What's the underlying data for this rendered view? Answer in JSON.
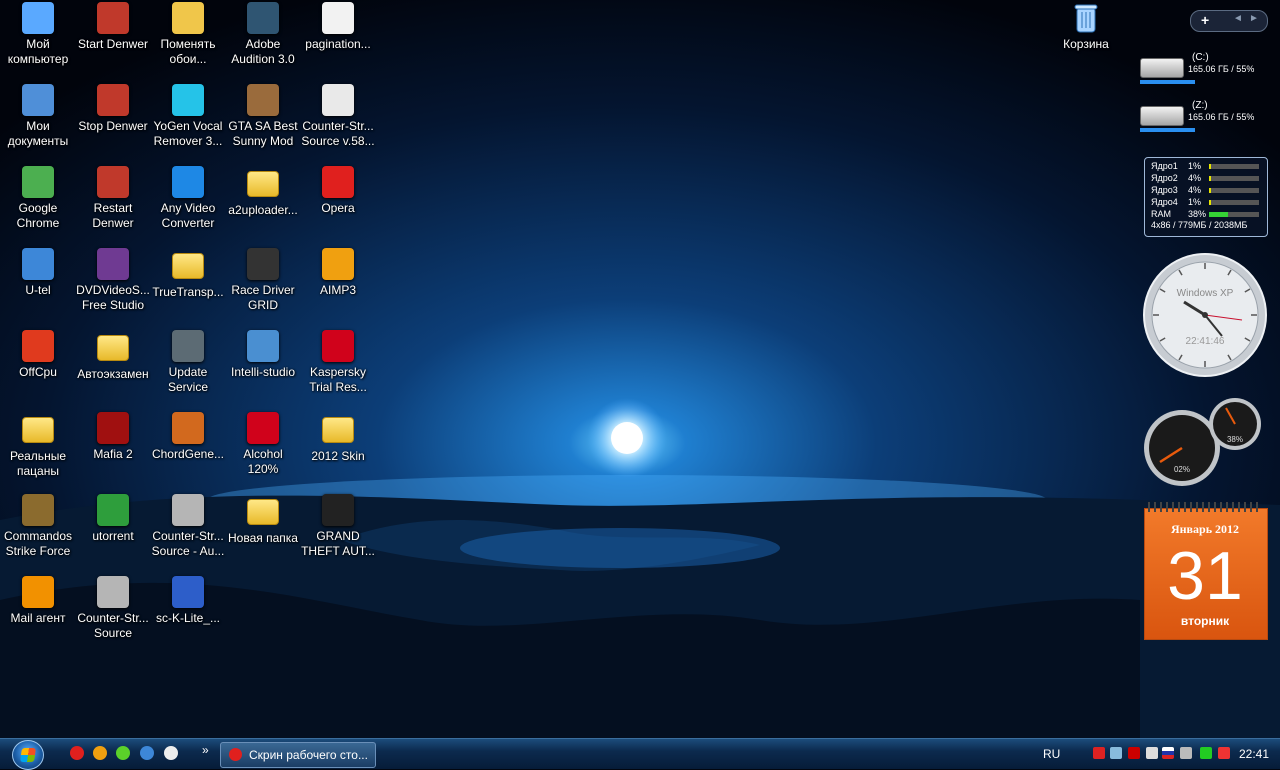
{
  "desktop_icons": [
    {
      "label": "Мой\nкомпьютер",
      "icon": "computer-icon"
    },
    {
      "label": "Start Denwer",
      "icon": "denwer-icon"
    },
    {
      "label": "Поменять\nобои...",
      "icon": "wallpaper-icon"
    },
    {
      "label": "Adobe\nAudition 3.0",
      "icon": "audition-icon"
    },
    {
      "label": "pagination...",
      "icon": "document-icon"
    },
    {
      "label": "Мои\nдокументы",
      "icon": "documents-icon"
    },
    {
      "label": "Stop Denwer",
      "icon": "denwer-icon"
    },
    {
      "label": "YoGen Vocal\nRemover 3...",
      "icon": "yogen-icon"
    },
    {
      "label": "GTA SA Best\nSunny Mod",
      "icon": "gta-icon"
    },
    {
      "label": "Counter-Str...\nSource v.58...",
      "icon": "window-icon"
    },
    {
      "label": "Google\nChrome",
      "icon": "chrome-icon"
    },
    {
      "label": "Restart\nDenwer",
      "icon": "denwer-icon"
    },
    {
      "label": "Any Video\nConverter",
      "icon": "video-converter-icon"
    },
    {
      "label": "a2uploader...",
      "icon": "folder-icon"
    },
    {
      "label": "Opera",
      "icon": "opera-icon"
    },
    {
      "label": "U-tel",
      "icon": "network-icon"
    },
    {
      "label": "DVDVideoS...\nFree Studio",
      "icon": "freestudio-icon"
    },
    {
      "label": "TrueTransp...",
      "icon": "folder-icon"
    },
    {
      "label": "Race Driver\nGRID",
      "icon": "grid-icon"
    },
    {
      "label": "AIMP3",
      "icon": "aimp-icon"
    },
    {
      "label": "OffCpu",
      "icon": "power-icon"
    },
    {
      "label": "Автоэкзамен",
      "icon": "folder-icon"
    },
    {
      "label": "Update\nService",
      "icon": "phone-icon"
    },
    {
      "label": "Intelli-studio",
      "icon": "intelli-icon"
    },
    {
      "label": "Kaspersky\nTrial Res...",
      "icon": "kaspersky-icon"
    },
    {
      "label": "Реальные\nпацаны",
      "icon": "folder-icon"
    },
    {
      "label": "Mafia 2",
      "icon": "mafia-icon"
    },
    {
      "label": "ChordGene...",
      "icon": "guitar-icon"
    },
    {
      "label": "Alcohol\n120%",
      "icon": "alcohol-icon"
    },
    {
      "label": "2012 Skin",
      "icon": "folder-icon"
    },
    {
      "label": "Commandos\nStrike Force",
      "icon": "commandos-icon"
    },
    {
      "label": "utorrent",
      "icon": "utorrent-icon"
    },
    {
      "label": "Counter-Str...\nSource - Au...",
      "icon": "counter-strike-icon"
    },
    {
      "label": "Новая папка",
      "icon": "folder-icon"
    },
    {
      "label": "GRAND\nTHEFT AUT...",
      "icon": "gta4-icon"
    },
    {
      "label": "Mail агент",
      "icon": "mail-agent-icon"
    },
    {
      "label": "Counter-Str...\nSource",
      "icon": "counter-strike-icon"
    },
    {
      "label": "sc-K-Lite_...",
      "icon": "klite-icon"
    }
  ],
  "recycle_bin": {
    "label": "Корзина",
    "icon": "recycle-bin-icon"
  },
  "drives": [
    {
      "name": "(C:)",
      "info": "165.06 ГБ / 55%",
      "fill": 0.55
    },
    {
      "name": "(Z:)",
      "info": "165.06 ГБ / 55%",
      "fill": 0.55
    }
  ],
  "cpu_meter": {
    "rows": [
      {
        "name": "Ядро1",
        "value": "1%",
        "fill": 0.01
      },
      {
        "name": "Ядро2",
        "value": "4%",
        "fill": 0.04
      },
      {
        "name": "Ядро3",
        "value": "4%",
        "fill": 0.04
      },
      {
        "name": "Ядро4",
        "value": "1%",
        "fill": 0.01
      },
      {
        "name": "RAM",
        "value": "38%",
        "fill": 0.38
      }
    ],
    "footer": "4x86 / 779МБ / 2038МБ"
  },
  "clock": {
    "brand": "Windows XP",
    "time": "22:41:46"
  },
  "speedometer": {
    "cpu_value": "02%",
    "ram_value": "38%"
  },
  "calendar": {
    "month": "Январь 2012",
    "day": "31",
    "weekday": "вторник"
  },
  "taskbar": {
    "task_label": "Скрин рабочего сто...",
    "language": "RU",
    "time": "22:41",
    "overflow": "»"
  },
  "gadget_bar": {
    "add": "+"
  },
  "colors": {
    "accent": "#1c4c7c",
    "calendar": "#e8611a"
  }
}
